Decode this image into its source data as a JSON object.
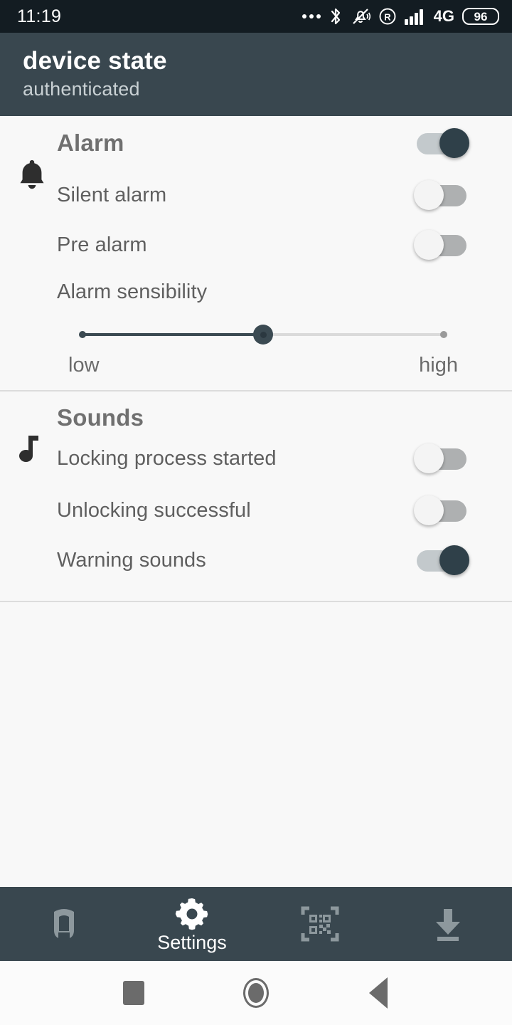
{
  "status_bar": {
    "time": "11:19",
    "icons": [
      "more-dots-icon",
      "bluetooth-icon",
      "vibrate-mute-icon",
      "roaming-icon",
      "signal-bars-icon"
    ],
    "network": "4G",
    "battery": "96"
  },
  "app_bar": {
    "title": "device state",
    "subtitle": "authenticated"
  },
  "sections": [
    {
      "id": "alarm",
      "icon": "bell-icon",
      "title": "Alarm",
      "title_toggle": {
        "label": "Alarm",
        "state": "on"
      },
      "rows": [
        {
          "label": "Silent alarm",
          "state": "off"
        },
        {
          "label": "Pre alarm",
          "state": "off"
        }
      ],
      "slider": {
        "label": "Alarm sensibility",
        "min_label": "low",
        "max_label": "high",
        "value_percent": 50
      }
    },
    {
      "id": "sounds",
      "icon": "music-note-icon",
      "title": "Sounds",
      "rows": [
        {
          "label": "Locking process started",
          "state": "off"
        },
        {
          "label": "Unlocking successful",
          "state": "off"
        },
        {
          "label": "Warning sounds",
          "state": "on"
        }
      ]
    }
  ],
  "bottom_nav": [
    {
      "icon": "lock-icon",
      "label": "",
      "active": false
    },
    {
      "icon": "gear-icon",
      "label": "Settings",
      "active": true
    },
    {
      "icon": "qr-scan-icon",
      "label": "",
      "active": false
    },
    {
      "icon": "download-icon",
      "label": "",
      "active": false
    }
  ],
  "android_nav": [
    "recents-square-icon",
    "home-circle-icon",
    "back-triangle-icon"
  ],
  "colors": {
    "header_bg": "#39474f",
    "status_bg": "#131c22",
    "accent": "#2f4049",
    "page_bg": "#f8f8f8",
    "divider": "#dcdcdc"
  }
}
